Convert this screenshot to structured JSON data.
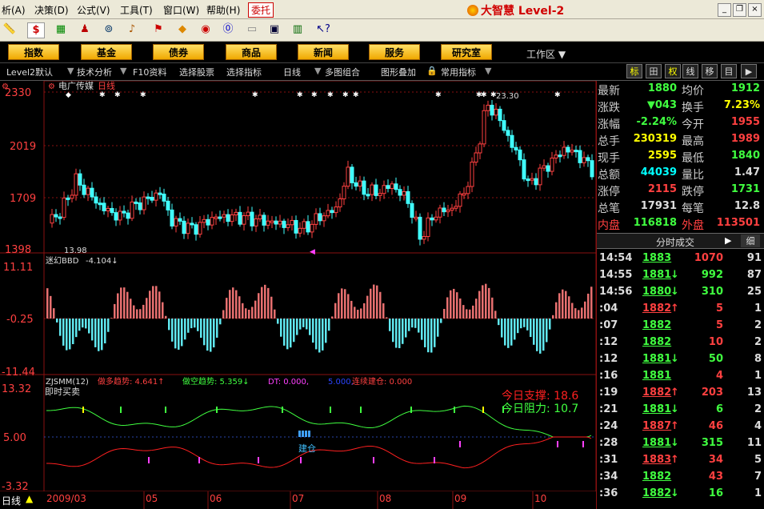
{
  "menu": {
    "items": [
      "析(A)",
      "决策(D)",
      "公式(V)",
      "工具(T)",
      "窗口(W)",
      "帮助(H)"
    ],
    "entrust_label": "委托",
    "brand": "大智慧 Level-2"
  },
  "toolbar": {
    "icons": [
      "ruler-icon",
      "dollar-icon",
      "money-icon",
      "people-icon",
      "binoculars-icon",
      "bell-icon",
      "alert-icon",
      "diamond-icon",
      "lips-icon",
      "f10-icon",
      "blank-icon",
      "window-icon",
      "books-icon",
      "help-arrow-icon"
    ]
  },
  "nav": {
    "buttons": [
      "指数",
      "基金",
      "债券",
      "商品",
      "新闻",
      "服务",
      "研究室"
    ],
    "workspace_label": "工作区"
  },
  "funcbar": {
    "items": [
      "Level2默认",
      "技术分析",
      "F10资料",
      "选择股票",
      "选择指标",
      "日线",
      "多图组合",
      "图形叠加",
      "常用指标"
    ],
    "tabs": [
      "标",
      "田",
      "权",
      "线",
      "移",
      "目",
      "▶"
    ]
  },
  "chart": {
    "stock_title": "电广传媒",
    "period_label": "日线",
    "bbd_label": "迷幻BBD",
    "bbd_value": "-4.104↓",
    "zj_label": "ZJSMM(12)",
    "zj_long": "做多趋势: 4.641↑",
    "zj_short": "做空趋势: 5.359↓",
    "zj_dt": "DT: 0.000,",
    "zj_val5": "5.000,",
    "zj_build": "连续建仓: 0.000",
    "instant_label": "即时买卖",
    "support": "今日支撑: 18.6",
    "resistance": "今日阻力: 10.7",
    "build_pos_label": "建仓",
    "low_annot": "13.98",
    "high_annot": "23.30",
    "status_period": "日线"
  },
  "chart_data": [
    {
      "type": "candlestick",
      "title": "电广传媒 日线",
      "y_ticks": [
        "2330",
        "2019",
        "1709",
        "1398"
      ],
      "annotations": [
        "13.98",
        "23.30"
      ]
    },
    {
      "type": "bar",
      "title": "迷幻BBD -4.104",
      "y_ticks": [
        "11.11",
        "-0.25",
        "-11.44"
      ]
    },
    {
      "type": "line",
      "title": "ZJSMM(12)",
      "y_ticks": [
        "13.32",
        "5.00",
        "-3.32"
      ]
    }
  ],
  "xaxis": {
    "labels": [
      "2009/03",
      "05",
      "06",
      "07",
      "08",
      "09",
      "10"
    ]
  },
  "quote": {
    "rows": [
      {
        "l1": "最新",
        "v1": "1880",
        "c1": "dn",
        "l2": "均价",
        "v2": "1912",
        "c2": "dn"
      },
      {
        "l1": "涨跌",
        "v1": "▼043",
        "c1": "dn",
        "l2": "换手",
        "v2": "7.23%",
        "c2": "yl"
      },
      {
        "l1": "涨幅",
        "v1": "-2.24%",
        "c1": "dn",
        "l2": "今开",
        "v2": "1955",
        "c2": "up"
      },
      {
        "l1": "总手",
        "v1": "230319",
        "c1": "yl",
        "l2": "最高",
        "v2": "1989",
        "c2": "up"
      },
      {
        "l1": "现手",
        "v1": "2595",
        "c1": "yl",
        "l2": "最低",
        "v2": "1840",
        "c2": "dn"
      },
      {
        "l1": "总额",
        "v1": "44039",
        "c1": "cy",
        "l2": "量比",
        "v2": "1.47",
        "c2": "wh"
      },
      {
        "l1": "涨停",
        "v1": "2115",
        "c1": "up",
        "l2": "跌停",
        "v2": "1731",
        "c2": "dn"
      },
      {
        "l1": "总笔",
        "v1": "17931",
        "c1": "wh",
        "l2": "每笔",
        "v2": "12.8",
        "c2": "wh"
      },
      {
        "l1": "内盘",
        "v1": "116818",
        "c1": "dn",
        "l2": "外盘",
        "v2": "113501",
        "c2": "up"
      }
    ],
    "trade_header": "分时成交",
    "trade_tab": "细",
    "trades": [
      {
        "t": "14:54",
        "p": "1883",
        "a": "",
        "v": "1070",
        "n": "91"
      },
      {
        "t": "14:55",
        "p": "1881",
        "a": "↓",
        "v": "992",
        "n": "87"
      },
      {
        "t": "14:56",
        "p": "1880",
        "a": "↓",
        "v": "310",
        "n": "25"
      },
      {
        "t": ":04",
        "p": "1882",
        "a": "↑",
        "v": "5",
        "n": "1"
      },
      {
        "t": ":07",
        "p": "1882",
        "a": "",
        "v": "5",
        "n": "2"
      },
      {
        "t": ":12",
        "p": "1882",
        "a": "",
        "v": "10",
        "n": "2"
      },
      {
        "t": ":12",
        "p": "1881",
        "a": "↓",
        "v": "50",
        "n": "8"
      },
      {
        "t": ":16",
        "p": "1881",
        "a": "",
        "v": "4",
        "n": "1"
      },
      {
        "t": ":19",
        "p": "1882",
        "a": "↑",
        "v": "203",
        "n": "13"
      },
      {
        "t": ":21",
        "p": "1881",
        "a": "↓",
        "v": "6",
        "n": "2"
      },
      {
        "t": ":24",
        "p": "1887",
        "a": "↑",
        "v": "46",
        "n": "4"
      },
      {
        "t": ":28",
        "p": "1881",
        "a": "↓",
        "v": "315",
        "n": "11"
      },
      {
        "t": ":31",
        "p": "1883",
        "a": "↑",
        "v": "34",
        "n": "5"
      },
      {
        "t": ":34",
        "p": "1882",
        "a": "",
        "v": "43",
        "n": "7"
      },
      {
        "t": ":36",
        "p": "1882",
        "a": "↓",
        "v": "16",
        "n": "1"
      }
    ]
  },
  "colors": {
    "up": "#ff4040",
    "down": "#40ffff",
    "green": "#40ff40",
    "grid": "#8a1010",
    "nav_button": "#f0a800"
  }
}
